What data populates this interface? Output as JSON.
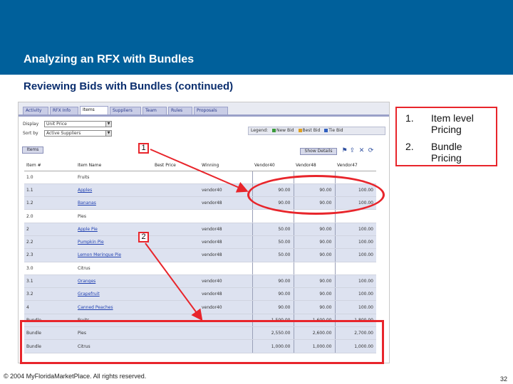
{
  "header": {
    "title": "Analyzing an RFX with Bundles",
    "subtitle": "Reviewing Bids with Bundles (continued)"
  },
  "tabs": [
    "Activity",
    "RFX Info",
    "Items",
    "Suppliers",
    "Team",
    "Rules",
    "Proposals"
  ],
  "form": {
    "display_label": "Display",
    "display_value": "Unit Price",
    "sortby_label": "Sort by",
    "sortby_value": "Active Suppliers"
  },
  "legend": {
    "label": "Legend:",
    "new_bid": "New Bid",
    "best_bid": "Best Bid",
    "tie_bid": "Tie Bid"
  },
  "toolbar": {
    "items_button": "Items",
    "show_details": "Show Details"
  },
  "table": {
    "headers": [
      "Item #",
      "Item Name",
      "Best Price",
      "Winning",
      "Vendor40",
      "Vendor48",
      "Vendor47"
    ],
    "rows": [
      {
        "kind": "group",
        "cells": [
          "1.0",
          "Fruits",
          "",
          "",
          "",
          "",
          ""
        ]
      },
      {
        "kind": "item",
        "cells": [
          "1.1",
          "Apples",
          "",
          "vendor40",
          "90.00",
          "90.00",
          "100.00"
        ]
      },
      {
        "kind": "item",
        "cells": [
          "1.2",
          "Bananas",
          "",
          "vendor48",
          "90.00",
          "90.00",
          "100.00"
        ]
      },
      {
        "kind": "group",
        "cells": [
          "2.0",
          "Pies",
          "",
          "",
          "",
          "",
          ""
        ]
      },
      {
        "kind": "item",
        "cells": [
          "2",
          "Apple Pie",
          "",
          "vendor48",
          "50.00",
          "90.00",
          "100.00"
        ]
      },
      {
        "kind": "item",
        "cells": [
          "2.2",
          "Pumpkin Pie",
          "",
          "vendor48",
          "50.00",
          "90.00",
          "100.00"
        ]
      },
      {
        "kind": "item",
        "cells": [
          "2.3",
          "Lemon Meringue Pie",
          "",
          "vendor48",
          "50.00",
          "90.00",
          "100.00"
        ]
      },
      {
        "kind": "group",
        "cells": [
          "3.0",
          "Citrus",
          "",
          "",
          "",
          "",
          ""
        ]
      },
      {
        "kind": "item",
        "cells": [
          "3.1",
          "Oranges",
          "",
          "vendor40",
          "90.00",
          "90.00",
          "100.00"
        ]
      },
      {
        "kind": "item",
        "cells": [
          "3.2",
          "Grapefruit",
          "",
          "vendor48",
          "90.00",
          "90.00",
          "100.00"
        ]
      },
      {
        "kind": "item",
        "cells": [
          "4",
          "Canned Peaches",
          "",
          "vendor40",
          "90.00",
          "90.00",
          "100.00"
        ]
      },
      {
        "kind": "bundle",
        "cells": [
          "Bundle",
          "Fruits",
          "",
          "",
          "1,500.00",
          "1,600.00",
          "1,800.00"
        ]
      },
      {
        "kind": "bundle",
        "cells": [
          "Bundle",
          "Pies",
          "",
          "",
          "2,550.00",
          "2,600.00",
          "2,700.00"
        ]
      },
      {
        "kind": "bundle",
        "cells": [
          "Bundle",
          "Citrus",
          "",
          "",
          "1,000.00",
          "1,000.00",
          "1,000.00"
        ]
      }
    ]
  },
  "annotations": {
    "tag1": "1",
    "tag2": "2"
  },
  "callout": {
    "items": [
      {
        "num": "1.",
        "text": "Item level Pricing"
      },
      {
        "num": "2.",
        "text": "Bundle Pricing"
      }
    ]
  },
  "footer": {
    "copyright": "© 2004 MyFloridaMarketPlace. All rights reserved.",
    "page": "32"
  },
  "colors": {
    "banner": "#00609b",
    "subtitle": "#0b2e6e",
    "highlight": "#e8252b",
    "row_shade": "#dde2f0"
  }
}
